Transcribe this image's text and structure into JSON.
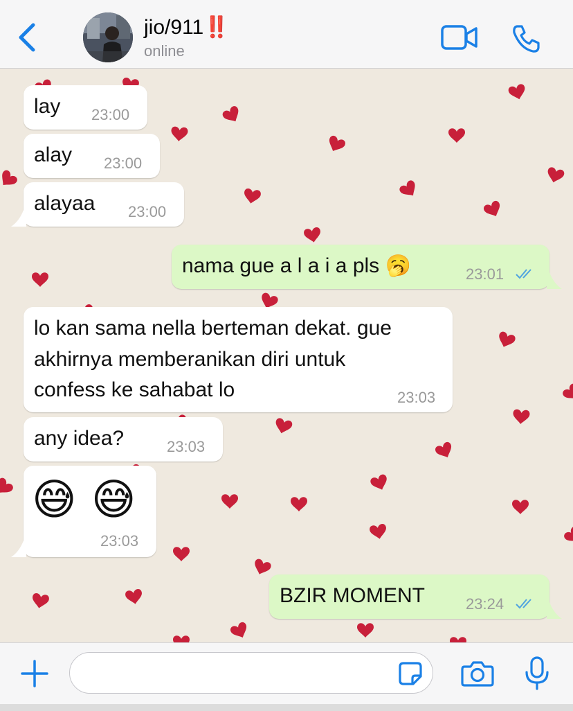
{
  "header": {
    "contact_name": "jio/911",
    "contact_emoji": "‼️",
    "status": "online",
    "back_icon": "chevron-left-icon",
    "video_icon": "video-camera-icon",
    "call_icon": "phone-icon",
    "accent": "#1a80e6"
  },
  "messages": [
    {
      "dir": "in",
      "lines": [
        "lay"
      ],
      "time": "23:00"
    },
    {
      "dir": "in",
      "lines": [
        "alay"
      ],
      "time": "23:00"
    },
    {
      "dir": "in",
      "lines": [
        "alayaa"
      ],
      "time": "23:00"
    },
    {
      "dir": "out",
      "lines": [
        "nama gue a l a i a pls 🥱"
      ],
      "time": "23:01",
      "read": true
    },
    {
      "dir": "in",
      "lines": [
        "lo kan sama nella berteman dekat. gue",
        "akhirnya memberanikan diri untuk",
        "confess ke sahabat lo"
      ],
      "time": "23:03"
    },
    {
      "dir": "in",
      "lines": [
        "any idea?"
      ],
      "time": "23:03"
    },
    {
      "dir": "in",
      "lines": [
        "😅 😅"
      ],
      "time": "23:03"
    },
    {
      "dir": "out",
      "lines": [
        "BZIR MOMENT"
      ],
      "time": "23:24",
      "read": true
    }
  ],
  "footer": {
    "plus_icon": "plus-icon",
    "input_value": "",
    "input_placeholder": "",
    "sticker_icon": "sticker-icon",
    "camera_icon": "camera-icon",
    "mic_icon": "microphone-icon"
  },
  "colors": {
    "incoming_bubble": "#ffffff",
    "outgoing_bubble": "#dcf8c6",
    "wallpaper": "#efe9df",
    "heart": "#c8203a",
    "read_ticks": "#4fa3e0"
  }
}
